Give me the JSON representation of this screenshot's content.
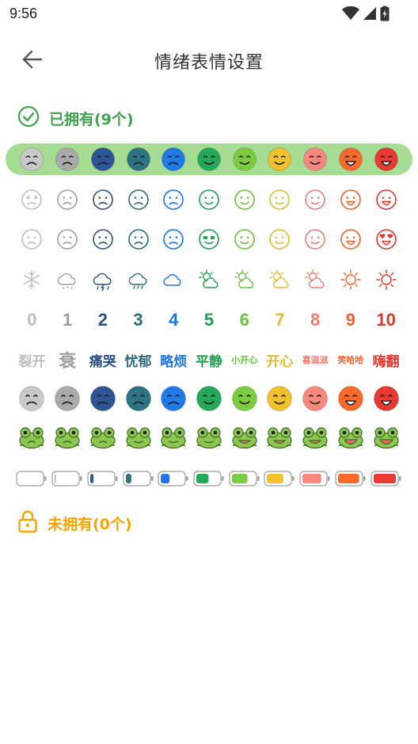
{
  "status": {
    "time": "9:56"
  },
  "header": {
    "title": "情绪表情设置"
  },
  "owned": {
    "label": "已拥有(9个)"
  },
  "unowned": {
    "label": "未拥有(0个)"
  },
  "levels": [
    {
      "n": "0",
      "label": "裂开",
      "color": "#bdbdbd",
      "fill": "#c9c9c9",
      "fs": 17
    },
    {
      "n": "1",
      "label": "衰",
      "color": "#9e9e9e",
      "fill": "#a9a9a9",
      "fs": 22
    },
    {
      "n": "2",
      "label": "痛哭",
      "color": "#2a4f86",
      "fill": "#2f5496",
      "fs": 17
    },
    {
      "n": "3",
      "label": "忧郁",
      "color": "#2b6b7b",
      "fill": "#2e7382",
      "fs": 17
    },
    {
      "n": "4",
      "label": "略烦",
      "color": "#1a73e8",
      "fill": "#1f7ae8",
      "fs": 17
    },
    {
      "n": "5",
      "label": "平静",
      "color": "#1e9e4f",
      "fill": "#25a85a",
      "fs": 17
    },
    {
      "n": "6",
      "label": "小开心",
      "color": "#6abf3b",
      "fill": "#7ccc3f",
      "fs": 11
    },
    {
      "n": "7",
      "label": "开心",
      "color": "#e8b92a",
      "fill": "#f0c12c",
      "fs": 17
    },
    {
      "n": "8",
      "label": "喜滋滋",
      "color": "#f07b74",
      "fill": "#f8877d",
      "fs": 11
    },
    {
      "n": "9",
      "label": "笑哈哈",
      "color": "#f2612c",
      "fill": "#f86a2b",
      "fs": 11
    },
    {
      "n": "10",
      "label": "嗨翻",
      "color": "#e0362c",
      "fill": "#e83a30",
      "fs": 17
    }
  ],
  "icons": {
    "selected_row": [
      "neutral-face-icon",
      "frown-face-icon",
      "frown-face-icon",
      "frown-face-icon",
      "frown-face-icon",
      "smile-face-icon",
      "smile-face-icon",
      "smile-face-icon",
      "smile-face-icon",
      "grin-face-icon",
      "laugh-face-icon"
    ],
    "line_faces_a": [
      "dizzy-face-icon",
      "crying-face-icon",
      "anxious-face-icon",
      "sad-face-icon",
      "sweat-face-icon",
      "content-face-icon",
      "wink-face-icon",
      "grin-face-icon",
      "tongue-face-icon",
      "big-smile-face-icon",
      "laughing-face-icon"
    ],
    "line_faces_b": [
      "squint-face-icon",
      "squint-face-icon",
      "worried-face-icon",
      "frown-face-icon",
      "confused-face-icon",
      "sunglasses-face-icon",
      "wink-face-icon",
      "laugh-face-icon",
      "grin-face-icon",
      "beaming-face-icon",
      "heart-eyes-face-icon"
    ],
    "weather": [
      "snowflake-icon",
      "snow-cloud-icon",
      "thunderstorm-icon",
      "rain-cloud-icon",
      "cloud-icon",
      "partly-sunny-icon",
      "partly-sunny-icon",
      "partly-sunny-icon",
      "sun-cloud-icon",
      "sun-icon",
      "sun-icon"
    ],
    "filled_faces": [
      "crying-face-icon",
      "frown-face-icon",
      "frown-face-icon",
      "frown-face-icon",
      "frown-face-icon",
      "smile-face-icon",
      "smile-face-icon",
      "smile-face-icon",
      "smile-face-icon",
      "grin-face-icon",
      "laugh-face-icon"
    ],
    "frogs": [
      "frog-icon",
      "frog-icon",
      "frog-icon",
      "frog-icon",
      "frog-icon",
      "frog-icon",
      "frog-icon",
      "frog-icon",
      "frog-icon",
      "frog-icon",
      "frog-icon"
    ],
    "batteries": [
      "battery-icon",
      "battery-icon",
      "battery-icon",
      "battery-icon",
      "battery-icon",
      "battery-icon",
      "battery-icon",
      "battery-icon",
      "battery-icon",
      "battery-icon",
      "battery-icon"
    ]
  },
  "battery_levels": [
    0,
    0.05,
    0.15,
    0.25,
    0.4,
    0.55,
    0.7,
    0.75,
    0.85,
    0.95,
    1
  ],
  "colors": {
    "owned": "#3fa34d",
    "unowned": "#f5a400",
    "selected_bg": "#a7dc94"
  }
}
